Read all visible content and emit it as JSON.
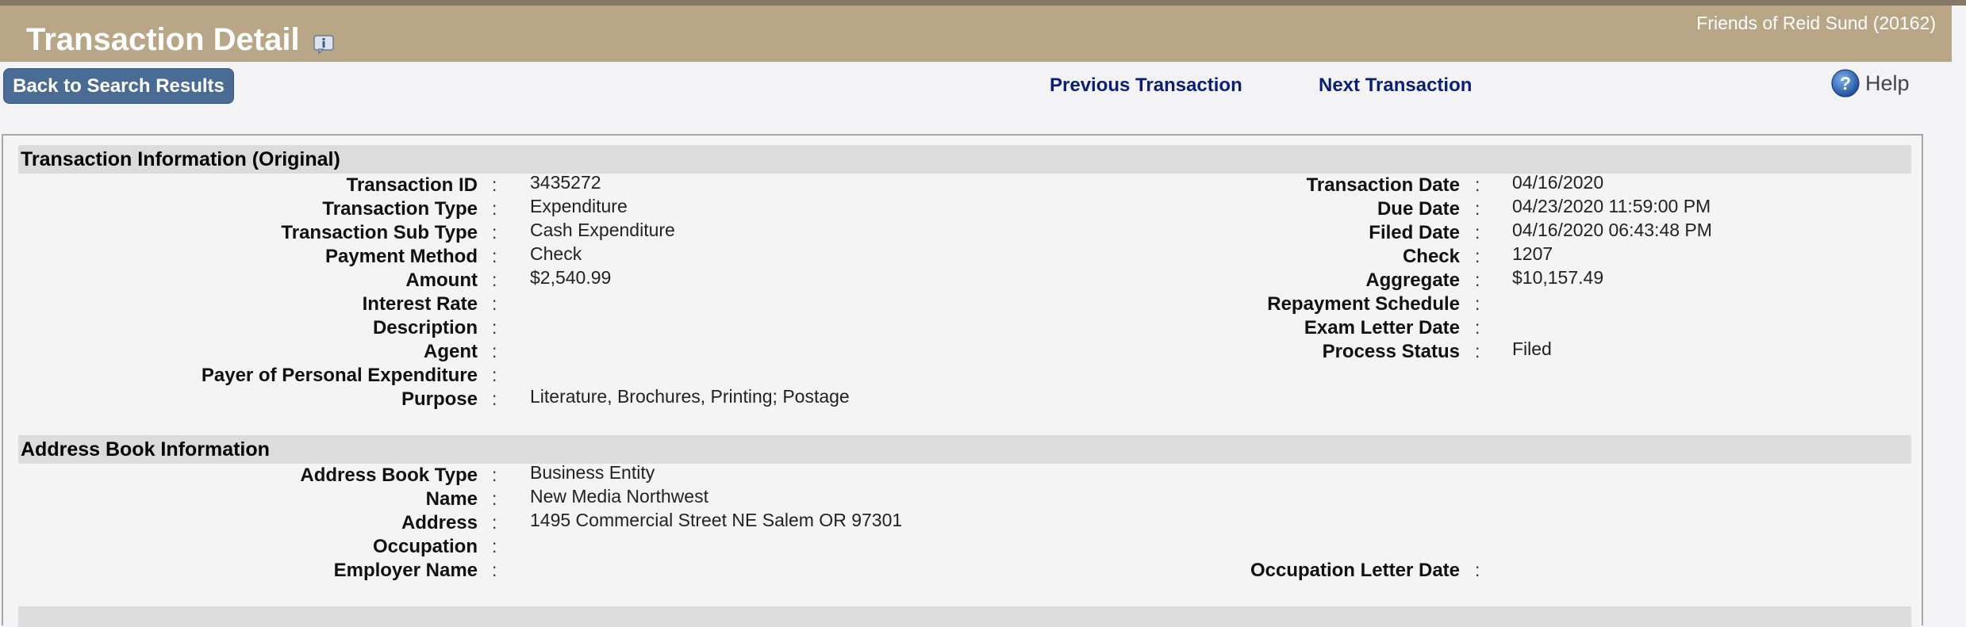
{
  "header": {
    "title": "Transaction Detail",
    "committee": "Friends of Reid Sund (20162)"
  },
  "toolbar": {
    "back_label": "Back to Search Results",
    "prev_label": "Previous Transaction",
    "next_label": "Next Transaction",
    "help_label": "Help"
  },
  "transaction": {
    "section_title": "Transaction Information  (Original)",
    "left": [
      {
        "label": "Transaction ID",
        "value": "3435272"
      },
      {
        "label": "Transaction Type",
        "value": "Expenditure"
      },
      {
        "label": "Transaction Sub Type",
        "value": "Cash Expenditure"
      },
      {
        "label": "Payment Method",
        "value": "Check"
      },
      {
        "label": "Amount",
        "value": "$2,540.99"
      },
      {
        "label": "Interest Rate",
        "value": ""
      },
      {
        "label": "Description",
        "value": ""
      },
      {
        "label": "Agent",
        "value": ""
      },
      {
        "label": "Payer of Personal Expenditure",
        "value": ""
      },
      {
        "label": "Purpose",
        "value": "Literature, Brochures, Printing; Postage"
      }
    ],
    "right": [
      {
        "label": "Transaction Date",
        "value": "04/16/2020"
      },
      {
        "label": "Due Date",
        "value": "04/23/2020 11:59:00 PM"
      },
      {
        "label": "Filed Date",
        "value": "04/16/2020 06:43:48 PM"
      },
      {
        "label": "Check",
        "value": "1207"
      },
      {
        "label": "Aggregate",
        "value": "$10,157.49"
      },
      {
        "label": "Repayment Schedule",
        "value": ""
      },
      {
        "label": "Exam Letter Date",
        "value": ""
      },
      {
        "label": "Process Status",
        "value": "Filed"
      }
    ]
  },
  "address_book": {
    "section_title": "Address Book Information",
    "left": [
      {
        "label": "Address Book Type",
        "value": "Business Entity"
      },
      {
        "label": "Name",
        "value": "New Media Northwest"
      },
      {
        "label": "Address",
        "value": "1495 Commercial Street NE Salem OR 97301"
      },
      {
        "label": "Occupation",
        "value": ""
      },
      {
        "label": "Employer Name",
        "value": ""
      }
    ],
    "right": [
      {
        "label": "Occupation Letter Date",
        "value": ""
      }
    ]
  },
  "colon": ":",
  "colors": {
    "header_bg": "#b8a687",
    "button_bg": "#4a6c94",
    "link": "#0d1f72",
    "section_bg": "#dcdcdc"
  },
  "icons": {
    "title_icon": "tooltip-info-icon",
    "help_icon": "help-question-icon"
  }
}
